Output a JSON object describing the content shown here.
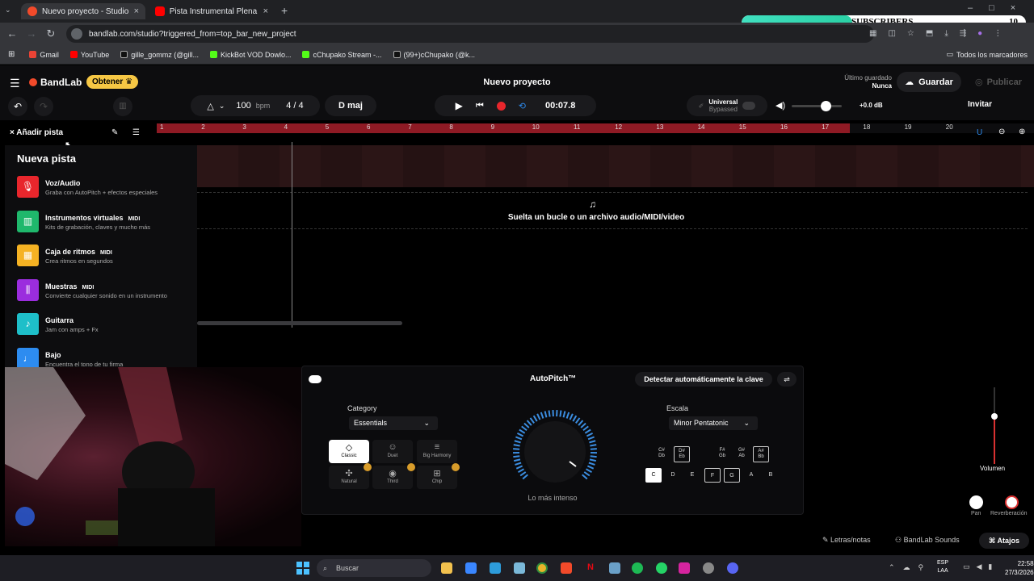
{
  "browser": {
    "tabs": [
      {
        "title": "Nuevo proyecto - Studio",
        "active": true
      },
      {
        "title": "Pista Instrumental Plena - El m",
        "active": false
      }
    ],
    "url": "bandlab.com/studio?triggered_from=top_bar_new_project",
    "bookmarks": [
      "Gmail",
      "YouTube",
      "gille_gommz (@gill...",
      "KickBot VOD Dowlo...",
      "cChupako Stream -...",
      "(99+)cChupako (@k..."
    ],
    "all_bookmarks": "Todos los marcadores"
  },
  "overlay": {
    "label": "SUBSCRIBERS",
    "count": "10",
    "progress": 0.39
  },
  "header": {
    "brand": "BandLab",
    "get_button": "Obtener",
    "project_title": "Nuevo proyecto",
    "last_saved_label": "Último guardado",
    "last_saved_value": "Nunca",
    "save_button": "Guardar",
    "publish_button": "Publicar"
  },
  "toolbar": {
    "tempo": "100",
    "tempo_unit": "bpm",
    "time_signature": "4 / 4",
    "key": "D maj",
    "time": "00:07.8",
    "autotune_name": "Universal",
    "autotune_state": "Bypassed",
    "master_gain": "+0.0 dB",
    "invite": "Invitar"
  },
  "ruler": {
    "ticks": [
      "1",
      "2",
      "3",
      "4",
      "5",
      "6",
      "7",
      "8",
      "9",
      "10",
      "11",
      "12",
      "13",
      "14",
      "15",
      "16",
      "17",
      "18",
      "19",
      "20"
    ]
  },
  "track_panel": {
    "add_track": "Añadir pista",
    "drop_text": "Suelta un bucle o un archivo audio/MIDI/video"
  },
  "sidebar": {
    "title": "Nueva pista",
    "items": [
      {
        "name": "Voz/Audio",
        "midi": "",
        "desc": "Graba con AutoPitch + efectos especiales",
        "color": "#e8262c"
      },
      {
        "name": "Instrumentos virtuales",
        "midi": "MIDI",
        "desc": "Kits de grabación, claves y mucho más",
        "color": "#1fb86c"
      },
      {
        "name": "Caja de ritmos",
        "midi": "MIDI",
        "desc": "Crea ritmos en segundos",
        "color": "#f5b223"
      },
      {
        "name": "Muestras",
        "midi": "MIDI",
        "desc": "Convierte cualquier sonido en un instrumento",
        "color": "#9b2dde"
      },
      {
        "name": "Guitarra",
        "midi": "",
        "desc": "Jam con amps + Fx",
        "color": "#1ebfc9"
      },
      {
        "name": "Bajo",
        "midi": "",
        "desc": "Encuentra el tono de tu firma",
        "color": "#2d8cf0"
      }
    ]
  },
  "autopitch": {
    "title": "AutoPitch™",
    "detect_button": "Detectar automáticamente la clave",
    "category_label": "Category",
    "category_value": "Essentials",
    "styles": [
      "Classic",
      "Duet",
      "Big Harmony",
      "Natural",
      "Third",
      "Chip"
    ],
    "knob_label": "Lo más intenso",
    "scale_label": "Escala",
    "scale_value": "Minor Pentatonic",
    "naturals": [
      "C",
      "D",
      "E",
      "F",
      "G",
      "A",
      "B"
    ],
    "sharps": [
      [
        "C#",
        "Db"
      ],
      [
        "D#",
        "Eb"
      ],
      [
        "F#",
        "Gb"
      ],
      [
        "G#",
        "Ab"
      ],
      [
        "A#",
        "Bb"
      ]
    ]
  },
  "mixer": {
    "volume_label": "Volumen",
    "pan_label": "Pan",
    "reverb_label": "Reverberación"
  },
  "bottom": {
    "lyrics": "Letras/notas",
    "sounds": "BandLab Sounds",
    "shortcuts": "Atajos"
  },
  "taskbar": {
    "search": "Buscar",
    "lang1": "ESP",
    "lang2": "LAA",
    "time": "22:58",
    "date": "27/3/2026"
  }
}
